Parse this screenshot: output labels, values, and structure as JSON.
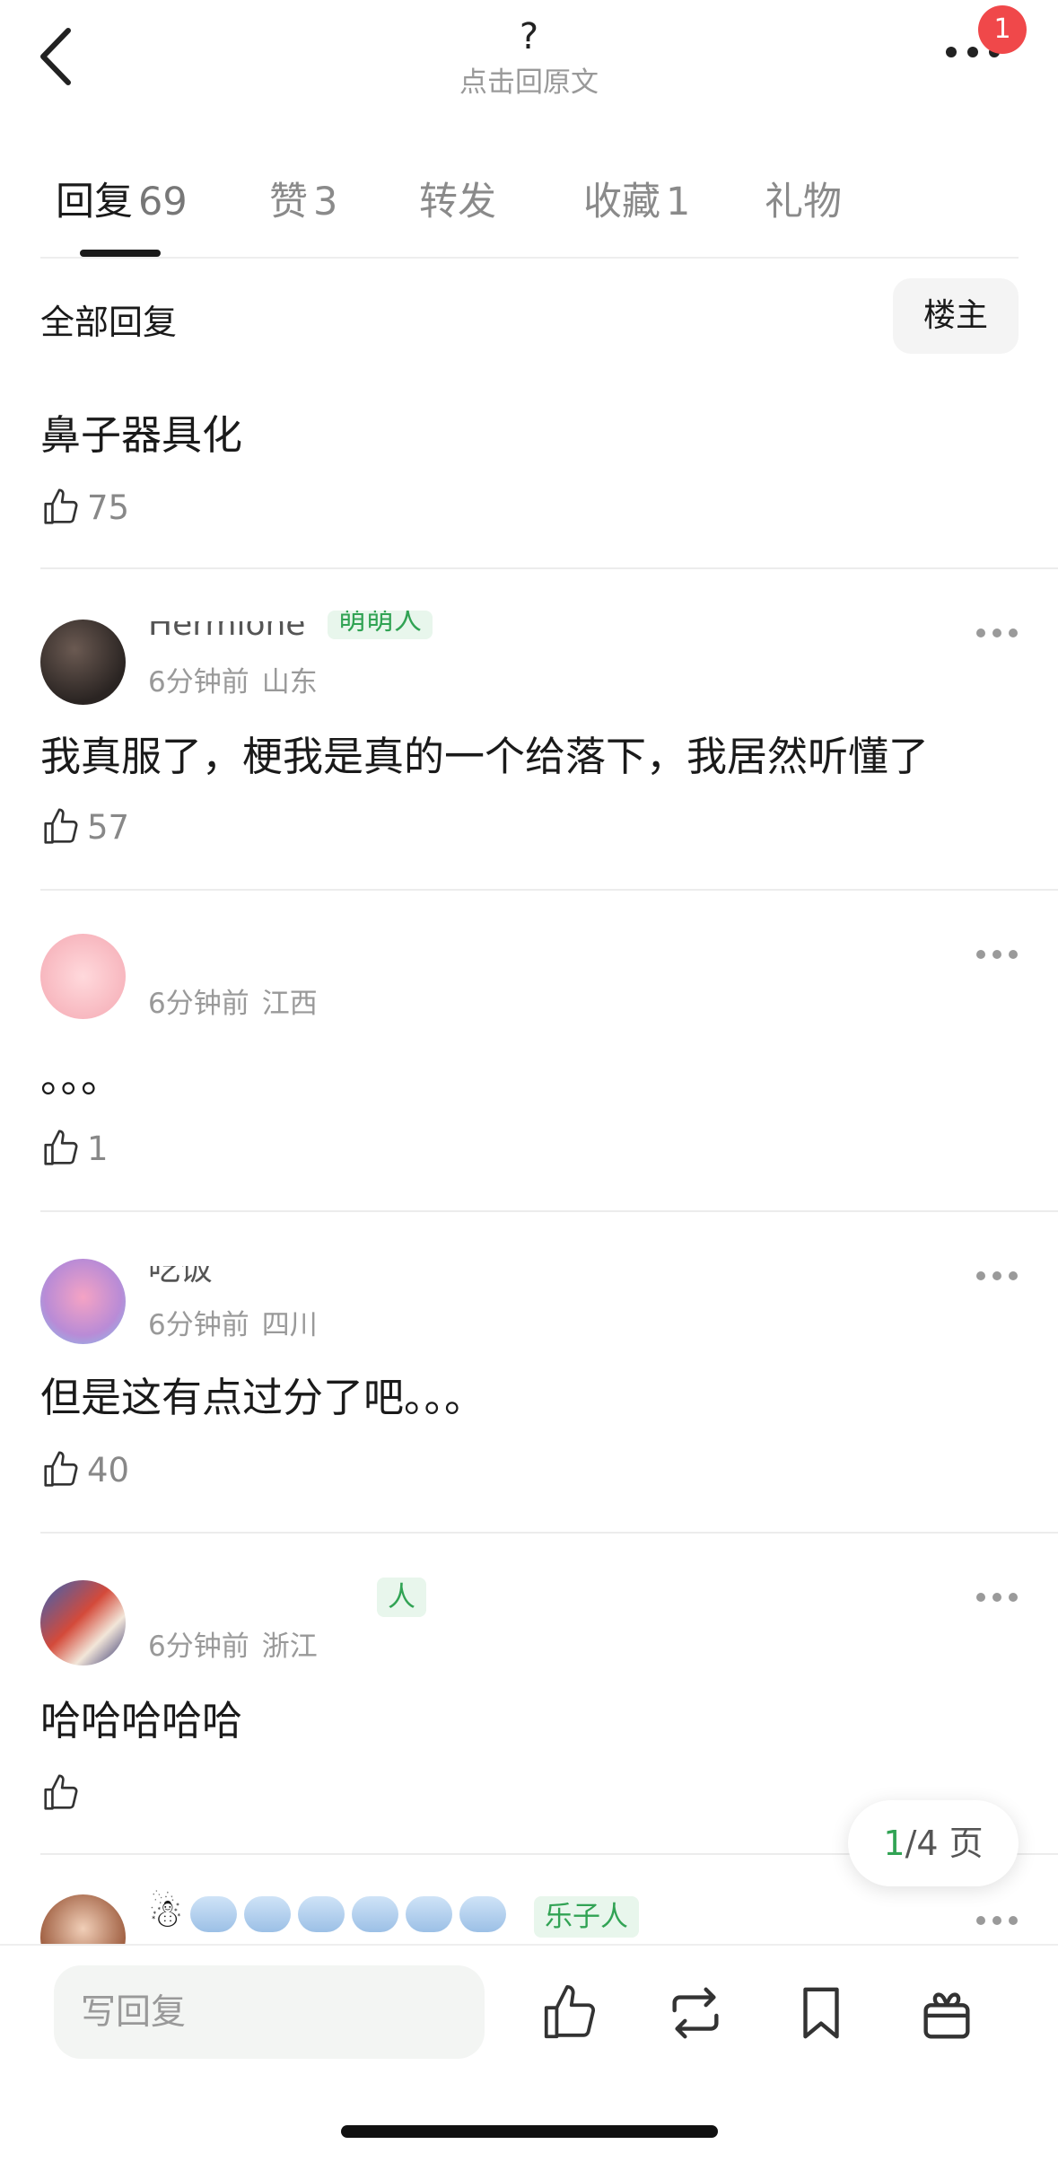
{
  "header": {
    "title": "?",
    "subtitle": "点击回原文",
    "badge_count": "1"
  },
  "tabs": [
    {
      "label": "回复",
      "count": "69"
    },
    {
      "label": "赞",
      "count": "3"
    },
    {
      "label": "转发",
      "count": ""
    },
    {
      "label": "收藏",
      "count": "1"
    },
    {
      "label": "礼物",
      "count": ""
    }
  ],
  "filter": {
    "label": "全部回复",
    "owner_button": "楼主"
  },
  "first_comment": {
    "body": "鼻子器具化",
    "likes": "75"
  },
  "comments": [
    {
      "name_fragment": "Hermione",
      "tag": "萌萌人",
      "time": "6分钟前",
      "location": "山东",
      "body": "我真服了，梗我是真的一个给落下，我居然听懂了",
      "likes": "57"
    },
    {
      "name_fragment": "",
      "tag": "",
      "time": "6分钟前",
      "location": "江西",
      "body": "。。。",
      "likes": "1"
    },
    {
      "name_fragment": "吃饭",
      "tag": "",
      "time": "6分钟前",
      "location": "四川",
      "body": "但是这有点过分了吧。。。",
      "likes": "40"
    },
    {
      "name_fragment": "",
      "tag": "人",
      "time": "6分钟前",
      "location": "浙江",
      "body": "哈哈哈哈哈",
      "likes": ""
    }
  ],
  "last_comment": {
    "tag": "乐子人"
  },
  "pager": {
    "current": "1",
    "total_text": "/4 页"
  },
  "bottom_bar": {
    "reply_placeholder": "写回复"
  },
  "colors": {
    "accent_green": "#31a354",
    "badge_red": "#f0484a"
  },
  "icons": [
    "back-arrow-icon",
    "more-icon",
    "thumb-up-icon",
    "repost-icon",
    "bookmark-icon",
    "gift-icon",
    "snowman-icon",
    "cloud-icon"
  ]
}
